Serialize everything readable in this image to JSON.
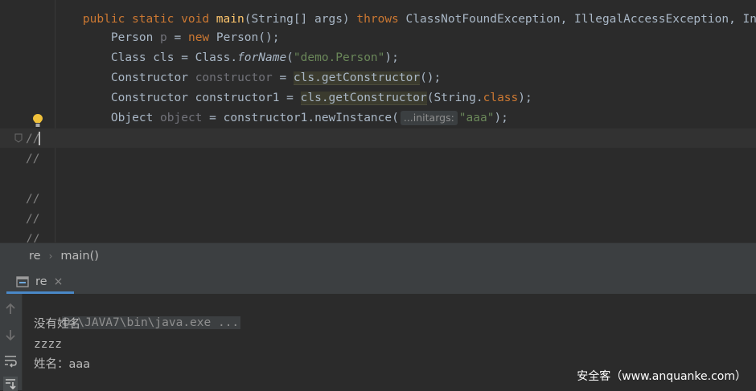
{
  "editor": {
    "line0": {
      "kw1": "public static void ",
      "method": "main",
      "args": "(String[] args) ",
      "throws": "throws ",
      "exceptions": "ClassNotFoundException, IllegalAccessException, Ins"
    },
    "line1": {
      "type": "Person ",
      "var": "p",
      "eq": " = ",
      "new": "new ",
      "rest": "Person();"
    },
    "line2": {
      "pre": "Class cls = Class.",
      "fn": "forName",
      "open": "(",
      "str": "\"demo.Person\"",
      "close": ");"
    },
    "line3": {
      "type": "Constructor ",
      "var": "constructor",
      "eq": " = ",
      "call": "cls.getConstructor",
      "rest": "();"
    },
    "line4": {
      "type": "Constructor constructor1 = ",
      "call": "cls.getConstructor",
      "open": "(String.",
      "kw": "class",
      "close": ");"
    },
    "line5": {
      "type": "Object ",
      "var": "object",
      "eq": " = constructor1.newInstance(",
      "hint": "...initargs:",
      "str": "\"aaa\"",
      "close": ");"
    },
    "comments": [
      "//",
      "//",
      "//",
      "//",
      "//"
    ]
  },
  "breadcrumb": {
    "items": [
      "re",
      "main()"
    ]
  },
  "run_panel": {
    "tab_label": "re",
    "close_glyph": "×",
    "toolbar_icons": [
      "up-arrow-icon",
      "down-arrow-icon",
      "soft-wrap-icon",
      "scroll-to-end-icon"
    ]
  },
  "console": {
    "command": "D:\\JAVA7\\bin\\java.exe ...",
    "lines": [
      "没有姓名",
      "zzzz",
      "姓名：aaa"
    ]
  },
  "watermark": "安全客（www.anquanke.com）",
  "colors": {
    "keyword": "#cc7832",
    "string": "#6a8759",
    "method": "#ffc66d",
    "text": "#a9b7c6",
    "tab_accent": "#4a88c7"
  }
}
